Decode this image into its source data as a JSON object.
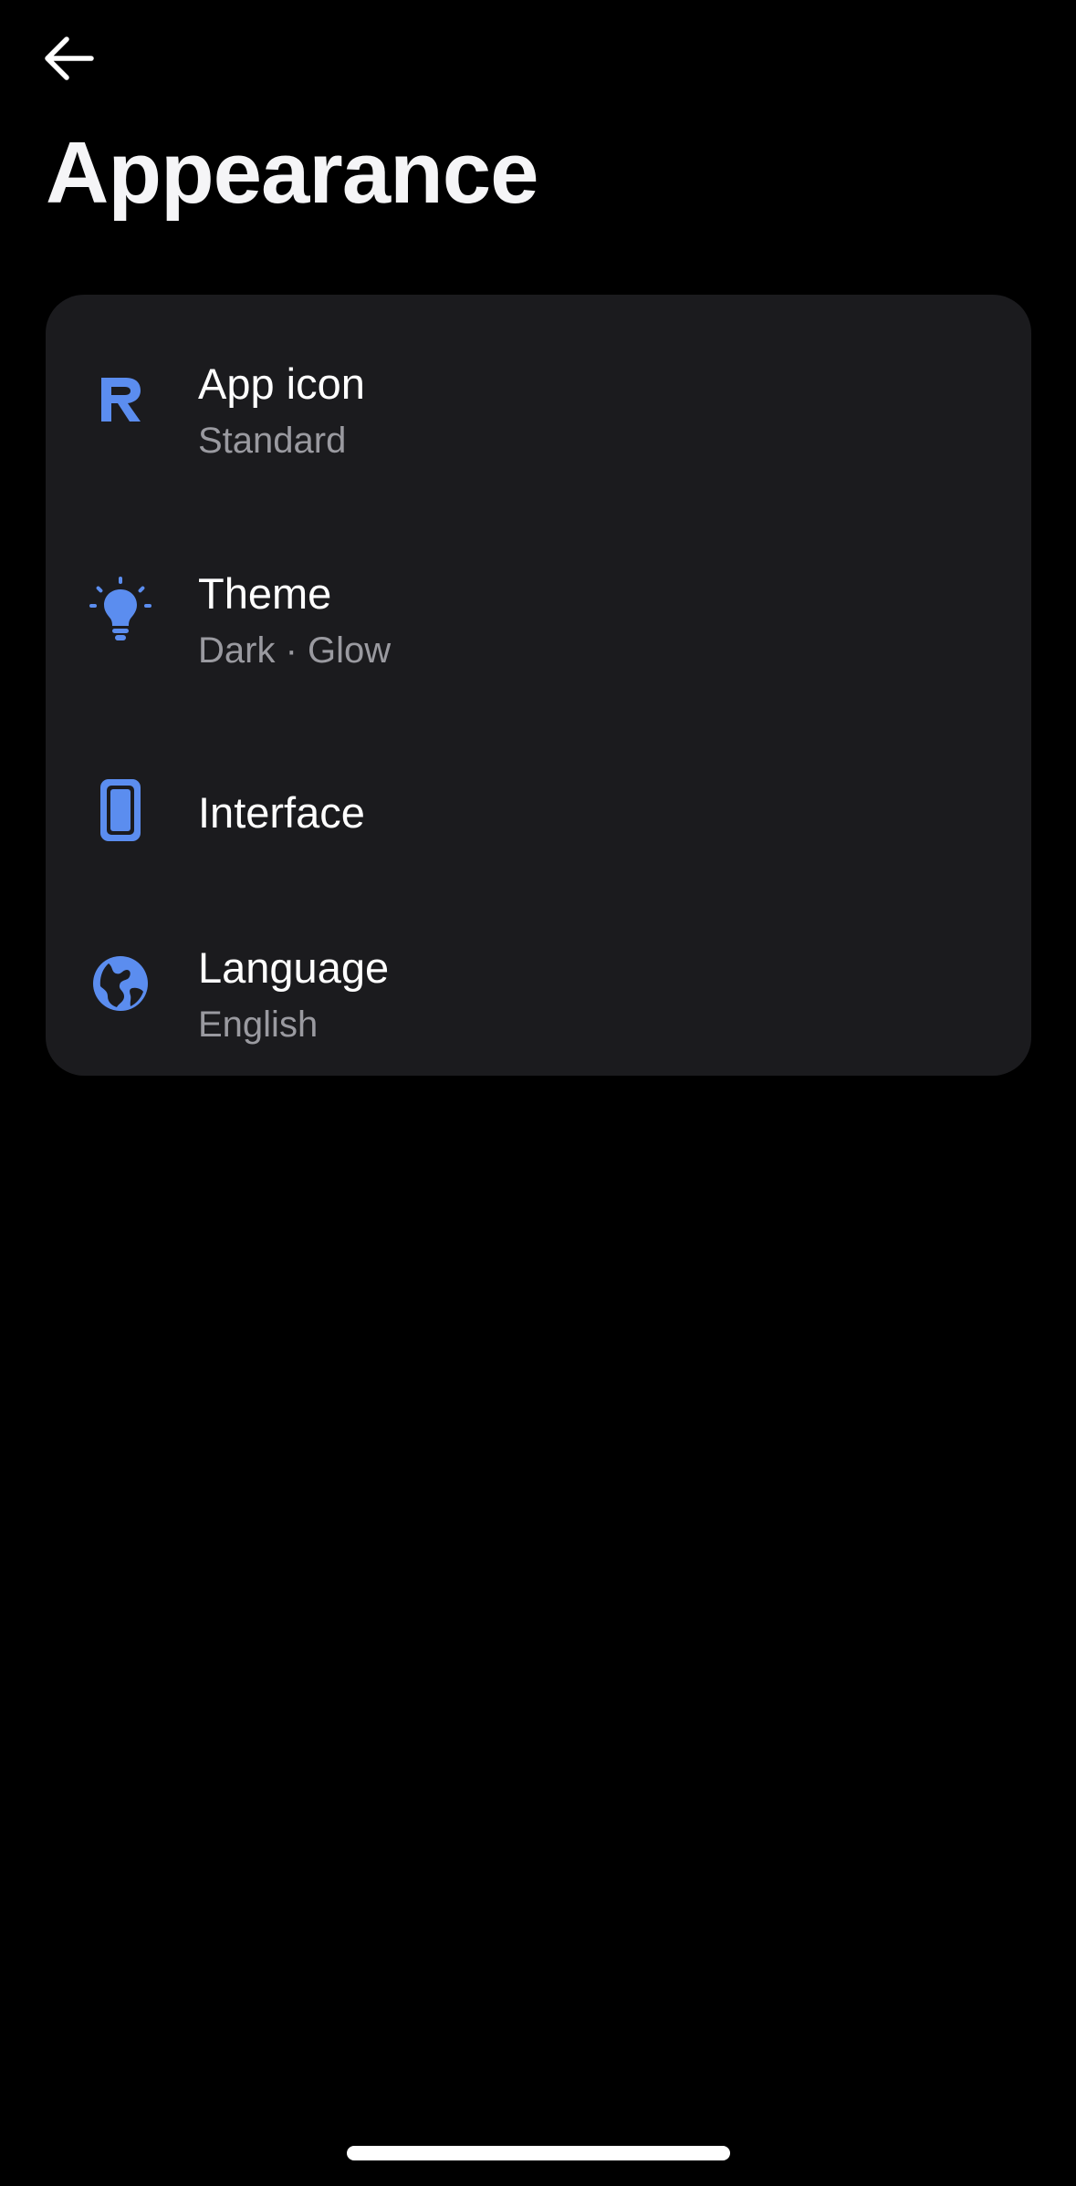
{
  "header": {
    "back_icon": "arrow-left-icon",
    "title": "Appearance"
  },
  "accent_color": "#5b8def",
  "settings": [
    {
      "id": "app-icon",
      "icon": "r-logo-icon",
      "title": "App icon",
      "subtitle": "Standard"
    },
    {
      "id": "theme",
      "icon": "lightbulb-icon",
      "title": "Theme",
      "subtitle": "Dark · Glow"
    },
    {
      "id": "interface",
      "icon": "phone-icon",
      "title": "Interface",
      "subtitle": ""
    },
    {
      "id": "language",
      "icon": "globe-icon",
      "title": "Language",
      "subtitle": "English"
    }
  ]
}
